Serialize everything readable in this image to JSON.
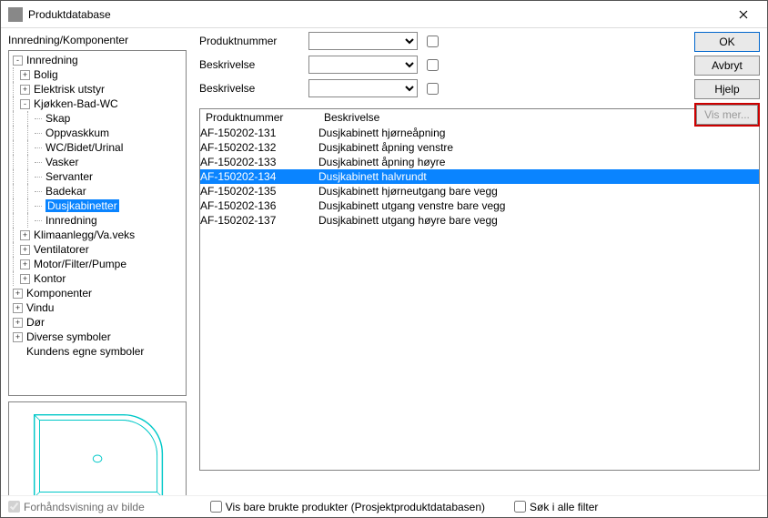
{
  "window": {
    "title": "Produktdatabase"
  },
  "tree": {
    "caption": "Innredning/Komponenter",
    "root": {
      "label": "Innredning",
      "exp": "-"
    },
    "lvl1": [
      {
        "label": "Bolig",
        "exp": "+"
      },
      {
        "label": "Elektrisk utstyr",
        "exp": "+"
      },
      {
        "label": "Kjøkken-Bad-WC",
        "exp": "-",
        "children": [
          {
            "label": "Skap"
          },
          {
            "label": "Oppvaskkum"
          },
          {
            "label": "WC/Bidet/Urinal"
          },
          {
            "label": "Vasker"
          },
          {
            "label": "Servanter"
          },
          {
            "label": "Badekar"
          },
          {
            "label": "Dusjkabinetter",
            "selected": true
          },
          {
            "label": "Innredning"
          }
        ]
      },
      {
        "label": "Klimaanlegg/Va.veks",
        "exp": "+"
      },
      {
        "label": "Ventilatorer",
        "exp": "+"
      },
      {
        "label": "Motor/Filter/Pumpe",
        "exp": "+"
      },
      {
        "label": "Kontor",
        "exp": "+"
      }
    ],
    "siblings": [
      {
        "label": "Komponenter",
        "exp": "+"
      },
      {
        "label": "Vindu",
        "exp": "+"
      },
      {
        "label": "Dør",
        "exp": "+"
      },
      {
        "label": "Diverse symboler",
        "exp": "+"
      },
      {
        "label": "Kundens egne symboler",
        "exp": " "
      }
    ]
  },
  "filters": {
    "row1_label": "Produktnummer",
    "row2_label": "Beskrivelse",
    "row3_label": "Beskrivelse"
  },
  "buttons": {
    "ok": "OK",
    "cancel": "Avbryt",
    "help": "Hjelp",
    "more": "Vis mer..."
  },
  "grid": {
    "col1": "Produktnummer",
    "col2": "Beskrivelse",
    "rows": [
      {
        "pn": "AF-150202-131",
        "desc": "Dusjkabinett hjørneåpning"
      },
      {
        "pn": "AF-150202-132",
        "desc": "Dusjkabinett åpning venstre"
      },
      {
        "pn": "AF-150202-133",
        "desc": "Dusjkabinett åpning høyre"
      },
      {
        "pn": "AF-150202-134",
        "desc": "Dusjkabinett halvrundt",
        "selected": true
      },
      {
        "pn": "AF-150202-135",
        "desc": "Dusjkabinett hjørneutgang bare vegg"
      },
      {
        "pn": "AF-150202-136",
        "desc": "Dusjkabinett utgang venstre bare vegg"
      },
      {
        "pn": "AF-150202-137",
        "desc": "Dusjkabinett utgang høyre bare vegg"
      }
    ]
  },
  "footer": {
    "preview": "Forhåndsvisning av bilde",
    "used_only": "Vis bare brukte produkter (Prosjektproduktdatabasen)",
    "search_all": "Søk i alle filter"
  }
}
